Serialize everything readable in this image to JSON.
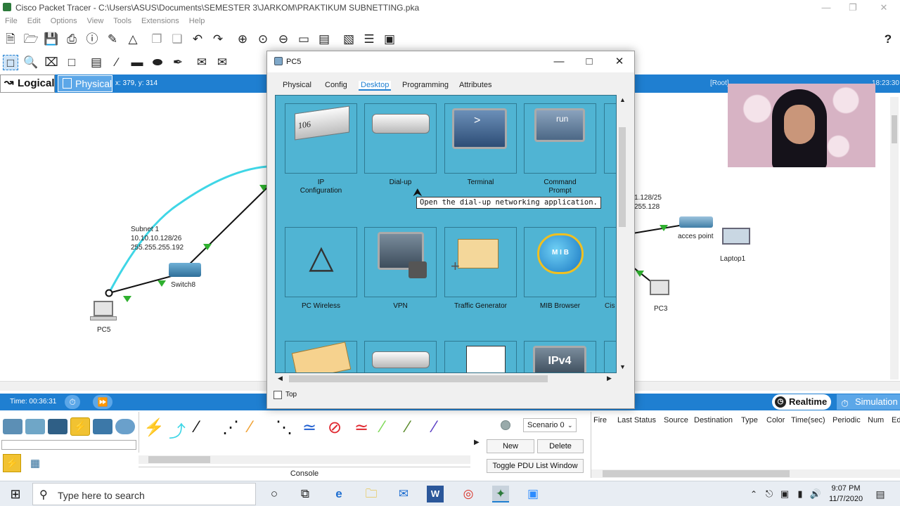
{
  "window": {
    "title": "Cisco Packet Tracer - C:\\Users\\ASUS\\Documents\\SEMESTER 3\\JARKOM\\PRAKTIKUM SUBNETTING.pka",
    "help": "?"
  },
  "menu": [
    "File",
    "Edit",
    "Options",
    "View",
    "Tools",
    "Extensions",
    "Help"
  ],
  "workspace_bar": {
    "logical": "Logical",
    "physical": "Physical",
    "coords": "x: 379, y: 314",
    "root": "[Root]",
    "clock": "18:23:30"
  },
  "topology": {
    "subnet_label": [
      "Subnet 1",
      "10.10.10.128/26",
      "255.255.255.192"
    ],
    "switch": "Switch8",
    "pc5": "PC5",
    "right_label": [
      "1.128/25",
      "255.128"
    ],
    "accesspoint": "acces point",
    "laptop": "Laptop1",
    "pc3": "PC3"
  },
  "timebar": {
    "time": "Time: 00:36:31",
    "realtime": "Realtime",
    "simulation": "Simulation"
  },
  "pdu": {
    "scenario": "Scenario 0",
    "new": "New",
    "delete": "Delete",
    "toggle": "Toggle PDU List Window",
    "columns": [
      "Fire",
      "Last Status",
      "Source",
      "Destination",
      "Type",
      "Color",
      "Time(sec)",
      "Periodic",
      "Num",
      "Ed"
    ]
  },
  "console": "Console",
  "dialog": {
    "title": "PC5",
    "tabs": [
      "Physical",
      "Config",
      "Desktop",
      "Programming",
      "Attributes"
    ],
    "active_tab": "Desktop",
    "apps_row1": [
      {
        "label": "IP\nConfiguration",
        "icon": "ip-config-icon",
        "badge": "106"
      },
      {
        "label": "Dial-up",
        "icon": "modem-icon"
      },
      {
        "label": "Terminal",
        "icon": "terminal-icon",
        "badge": ">"
      },
      {
        "label": "Command\nPrompt",
        "icon": "command-prompt-icon",
        "badge": "run"
      }
    ],
    "apps_row2": [
      {
        "label": "PC Wireless",
        "icon": "wireless-tower-icon"
      },
      {
        "label": "VPN",
        "icon": "vpn-monitor-icon"
      },
      {
        "label": "Traffic Generator",
        "icon": "traffic-generator-icon"
      },
      {
        "label": "MIB Browser",
        "icon": "mib-browser-icon",
        "badge": "M I B"
      },
      {
        "label": "Cis",
        "icon": "cisco-partial-icon"
      }
    ],
    "apps_row3_badge": "IPv4",
    "tooltip": "Open the dial-up networking application.",
    "top_checkbox": "Top"
  },
  "taskbar": {
    "search_placeholder": "Type here to search",
    "time": "9:07 PM",
    "date": "11/7/2020"
  },
  "colors": {
    "accent": "#1f7fd1",
    "desktop_bg": "#4fb3d2",
    "link_cyan": "#3fd6e6",
    "link_green": "#2fb02f"
  }
}
